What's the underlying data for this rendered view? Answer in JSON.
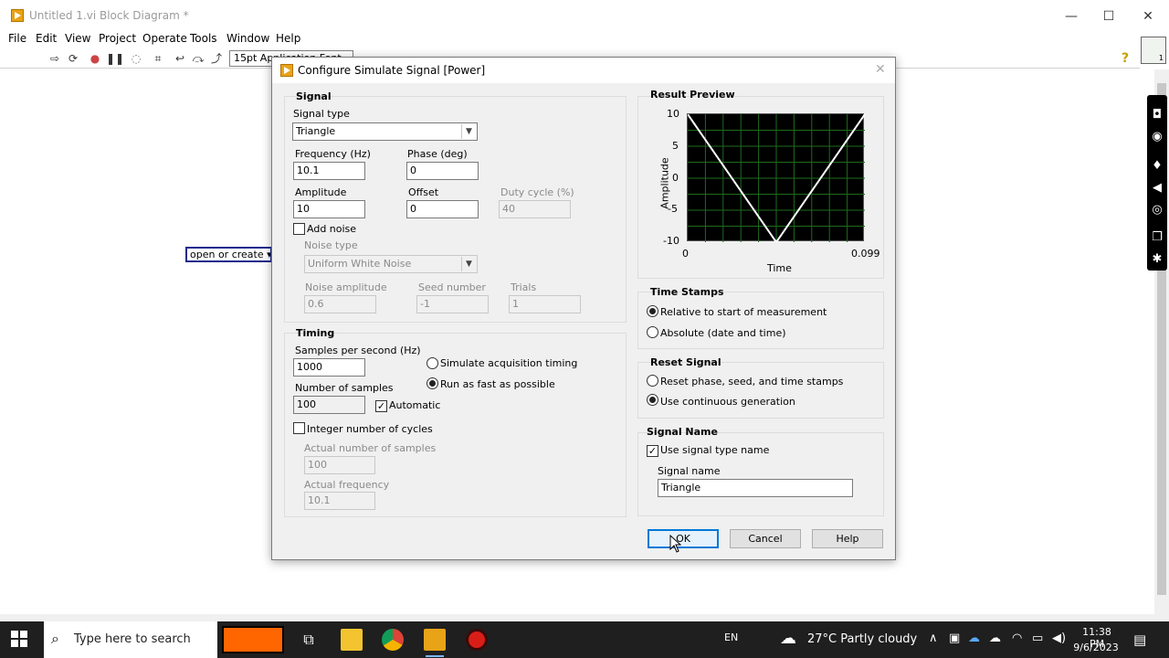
{
  "window": {
    "title": "Untitled 1.vi Block Diagram *",
    "controls": {
      "minimize": "—",
      "maximize": "☐",
      "close": "✕"
    }
  },
  "menu": [
    "File",
    "Edit",
    "View",
    "Project",
    "Operate",
    "Tools",
    "Window",
    "Help"
  ],
  "toolbar": {
    "font_label": "15pt Application Font"
  },
  "diagram": {
    "open_create_label": "open or create"
  },
  "dialog": {
    "title": "Configure Simulate Signal [Power]",
    "signal": {
      "title": "Signal",
      "signal_type_label": "Signal type",
      "signal_type_value": "Triangle",
      "frequency_label": "Frequency (Hz)",
      "frequency_value": "10.1",
      "phase_label": "Phase (deg)",
      "phase_value": "0",
      "amplitude_label": "Amplitude",
      "amplitude_value": "10",
      "offset_label": "Offset",
      "offset_value": "0",
      "duty_cycle_label": "Duty cycle (%)",
      "duty_cycle_value": "40",
      "add_noise_label": "Add noise",
      "add_noise_checked": false,
      "noise_type_label": "Noise type",
      "noise_type_value": "Uniform White Noise",
      "noise_amplitude_label": "Noise amplitude",
      "noise_amplitude_value": "0.6",
      "seed_number_label": "Seed number",
      "seed_number_value": "-1",
      "trials_label": "Trials",
      "trials_value": "1"
    },
    "timing": {
      "title": "Timing",
      "samples_per_second_label": "Samples per second (Hz)",
      "samples_per_second_value": "1000",
      "simulate_acquisition_label": "Simulate acquisition timing",
      "run_fast_label": "Run as fast as possible",
      "number_of_samples_label": "Number of samples",
      "number_of_samples_value": "100",
      "automatic_label": "Automatic",
      "automatic_checked": true,
      "integer_cycles_label": "Integer number of cycles",
      "integer_cycles_checked": false,
      "actual_samples_label": "Actual number of samples",
      "actual_samples_value": "100",
      "actual_frequency_label": "Actual frequency",
      "actual_frequency_value": "10.1"
    },
    "preview": {
      "title": "Result Preview",
      "ylabel": "Amplitude",
      "xlabel": "Time"
    },
    "time_stamps": {
      "title": "Time Stamps",
      "relative_label": "Relative to start of measurement",
      "absolute_label": "Absolute (date and time)"
    },
    "reset_signal": {
      "title": "Reset Signal",
      "reset_label": "Reset phase, seed, and time stamps",
      "continuous_label": "Use continuous generation"
    },
    "signal_name": {
      "title": "Signal Name",
      "use_type_name_label": "Use signal type name",
      "use_type_name_checked": true,
      "name_label": "Signal name",
      "name_value": "Triangle"
    },
    "buttons": {
      "ok": "OK",
      "cancel": "Cancel",
      "help": "Help"
    }
  },
  "chart_data": {
    "type": "line",
    "title": "Result Preview",
    "xlabel": "Time",
    "ylabel": "Amplitude",
    "xlim": [
      0,
      0.099
    ],
    "ylim": [
      -10,
      10
    ],
    "x_tick_labels": [
      "0",
      "0.099"
    ],
    "y_tick_labels": [
      "10",
      "5",
      "0",
      "-5",
      "-10"
    ],
    "y_ticks": [
      10,
      5,
      0,
      -5,
      -10
    ],
    "grid": true,
    "series": [
      {
        "x": [
          0,
          0.0495,
          0.099
        ],
        "y": [
          10,
          -10,
          10
        ],
        "color": "#ffffff"
      }
    ],
    "background": "#000000",
    "grid_color": "#1e6b1e"
  },
  "taskbar": {
    "search_placeholder": "Type here to search",
    "language": "EN",
    "weather": "27°C  Partly cloudy",
    "time": "11:38 PM",
    "date": "9/6/2023"
  }
}
